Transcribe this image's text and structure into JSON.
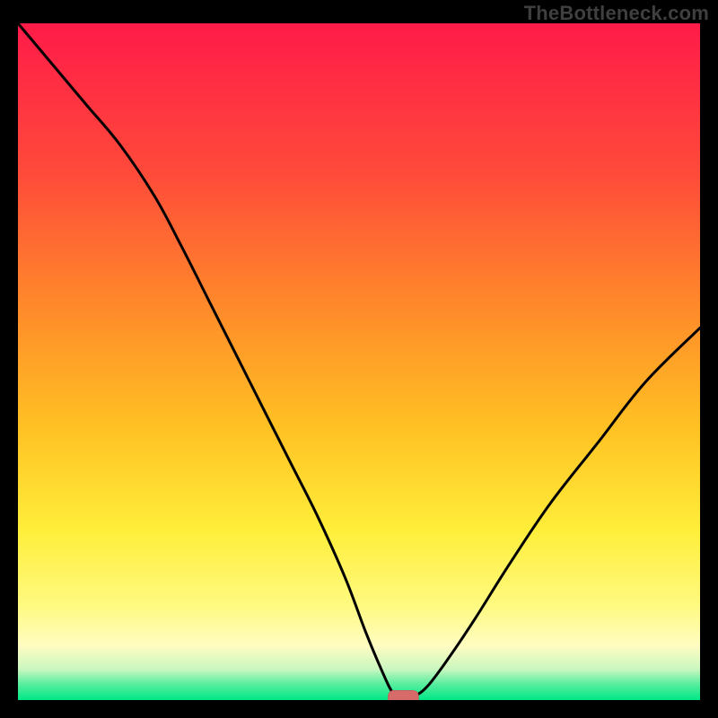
{
  "attribution": "TheBottleneck.com",
  "colors": {
    "background": "#000000",
    "gradient_top": "#ff1b49",
    "gradient_mid1": "#ff6a2a",
    "gradient_mid2": "#ffc223",
    "gradient_mid3": "#ffee3a",
    "gradient_pale": "#fffcc2",
    "gradient_green": "#00e786",
    "curve": "#000000",
    "marker_fill": "#d76b6a",
    "marker_stroke": "#cc5d5c",
    "attribution_text": "#3f3f3f"
  },
  "chart_data": {
    "type": "line",
    "title": "",
    "xlabel": "",
    "ylabel": "",
    "xlim": [
      0,
      100
    ],
    "ylim": [
      0,
      100
    ],
    "grid": false,
    "gradient_stops": [
      {
        "offset": 0.0,
        "color": "#ff1b49"
      },
      {
        "offset": 0.22,
        "color": "#ff4a3a"
      },
      {
        "offset": 0.42,
        "color": "#ff8a2a"
      },
      {
        "offset": 0.6,
        "color": "#ffc223"
      },
      {
        "offset": 0.75,
        "color": "#ffee3a"
      },
      {
        "offset": 0.86,
        "color": "#fffa80"
      },
      {
        "offset": 0.92,
        "color": "#fffcc2"
      },
      {
        "offset": 0.955,
        "color": "#c8f7bf"
      },
      {
        "offset": 0.975,
        "color": "#5eeea0"
      },
      {
        "offset": 1.0,
        "color": "#00e786"
      }
    ],
    "series": [
      {
        "name": "bottleneck-curve",
        "x": [
          0,
          5,
          10,
          15,
          20,
          24,
          28,
          32,
          36,
          40,
          44,
          48,
          51,
          53.5,
          55,
          56.5,
          58,
          60,
          63,
          67,
          72,
          78,
          85,
          92,
          100
        ],
        "y": [
          100,
          94,
          88,
          82,
          74.5,
          67,
          59,
          51,
          43,
          35,
          27,
          18,
          10,
          4,
          1,
          0,
          0.5,
          2,
          6,
          12,
          20,
          29,
          38,
          47,
          55
        ]
      }
    ],
    "marker": {
      "x": 56.5,
      "y": 0,
      "rx": 2.2,
      "ry": 1.0
    },
    "annotations": []
  }
}
